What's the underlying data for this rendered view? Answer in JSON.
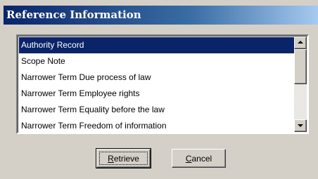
{
  "dialog": {
    "title": "Reference Information"
  },
  "list": {
    "items": [
      "Authority Record",
      "Scope Note",
      "Narrower Term Due process of law",
      "Narrower Term Employee rights",
      "Narrower Term Equality before the law",
      "Narrower Term Freedom of information"
    ],
    "selected": "Authority Record"
  },
  "scrollbar": {
    "up_icon": "arrow-up",
    "down_icon": "arrow-down"
  },
  "buttons": {
    "retrieve": {
      "mnemonic": "R",
      "rest": "etrieve"
    },
    "cancel": {
      "mnemonic": "C",
      "rest": "ancel"
    }
  },
  "colors": {
    "title_start": "#0a246a",
    "title_end": "#a6caf0",
    "selection": "#0a246a",
    "face": "#d4d0c8"
  }
}
